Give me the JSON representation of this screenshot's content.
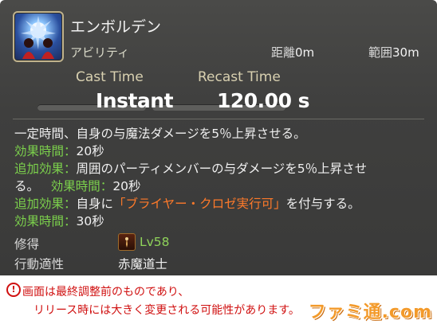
{
  "skill": {
    "name": "エンボルデン",
    "type": "アビリティ",
    "range_label": "距離",
    "range_value": "0m",
    "radius_label": "範囲",
    "radius_value": "30m"
  },
  "stats": {
    "cast_label": "Cast Time",
    "cast_value": "Instant",
    "recast_label": "Recast Time",
    "recast_value": "120.00 s"
  },
  "description": {
    "line1": "一定時間、自身の与魔法ダメージを5％上昇させる。",
    "dur1_label": "効果時間：",
    "dur1_value": "20秒",
    "add1_label": "追加効果：",
    "add1_text_a": "周囲のパーティメンバーの与ダメージを5％上昇させ",
    "add1_text_b": "る。",
    "dur2_label": "効果時間：",
    "dur2_value": "20秒",
    "add2_label": "追加効果：",
    "add2_pre": "自身に",
    "add2_highlight": "「ブライヤー・クロゼ実行可」",
    "add2_post": "を付与する。",
    "dur3_label": "効果時間：",
    "dur3_value": "30秒"
  },
  "acquisition": {
    "label": "修得",
    "level": "Lv58",
    "icon": "red-mage-job-icon"
  },
  "job": {
    "label": "行動適性",
    "value": "赤魔道士"
  },
  "notice": {
    "icon": "warning-icon",
    "line1": "画面は最終調整前のものであり、",
    "line2": "リリース時には大きく変更される可能性があります。"
  },
  "watermark": {
    "text": "ファミ通.com"
  },
  "colors": {
    "effect_green": "#7cd14c",
    "status_orange": "#ff7a2a",
    "notice_red": "#d01010"
  }
}
